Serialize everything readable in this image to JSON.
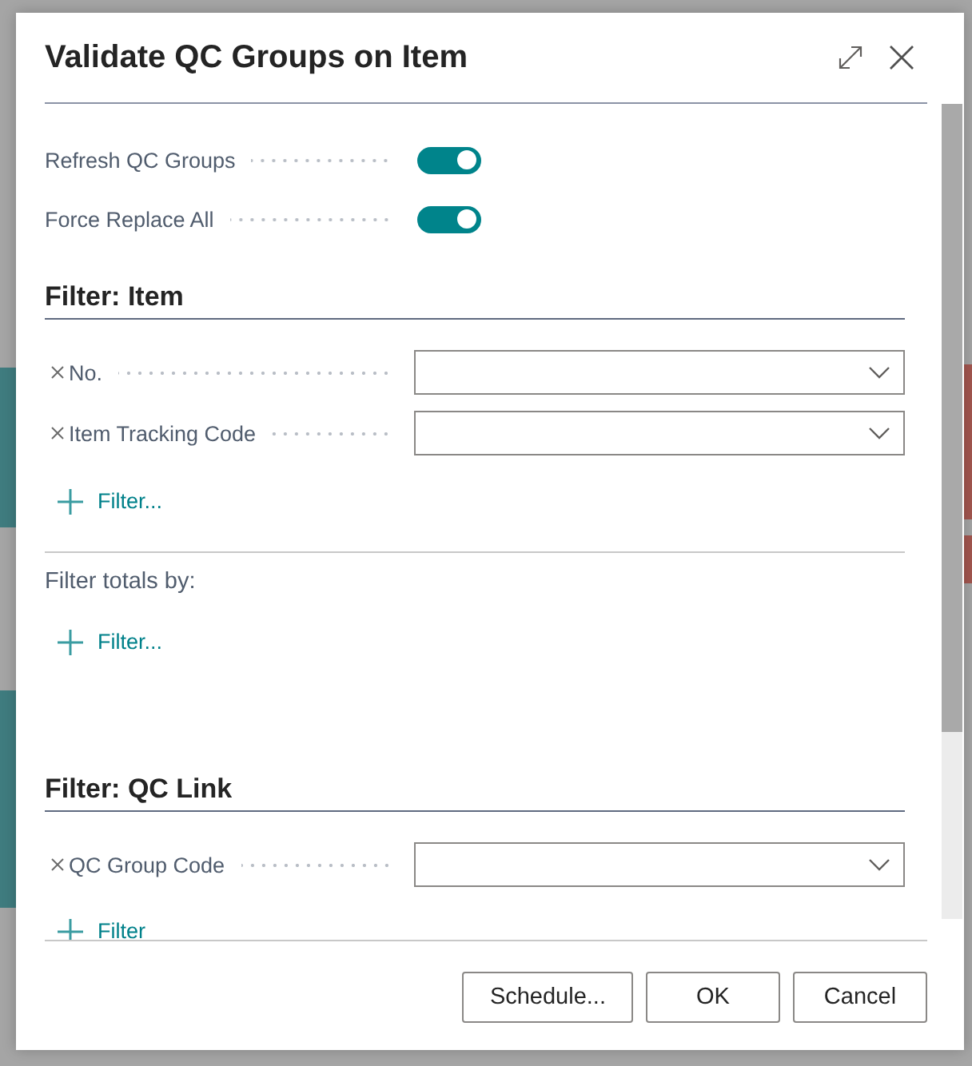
{
  "dialog": {
    "title": "Validate QC Groups on Item"
  },
  "options": [
    {
      "label": "Refresh QC Groups",
      "on": true
    },
    {
      "label": "Force Replace All",
      "on": true
    }
  ],
  "sections": [
    {
      "heading": "Filter: Item",
      "filters": [
        {
          "label": "No."
        },
        {
          "label": "Item Tracking Code"
        }
      ],
      "add_filter": "Filter...",
      "totals": {
        "label": "Filter totals by:",
        "add_filter": "Filter..."
      }
    },
    {
      "heading": "Filter: QC Link",
      "filters": [
        {
          "label": "QC Group Code"
        }
      ],
      "add_filter": "Filter"
    }
  ],
  "buttons": [
    "Schedule...",
    "OK",
    "Cancel"
  ]
}
